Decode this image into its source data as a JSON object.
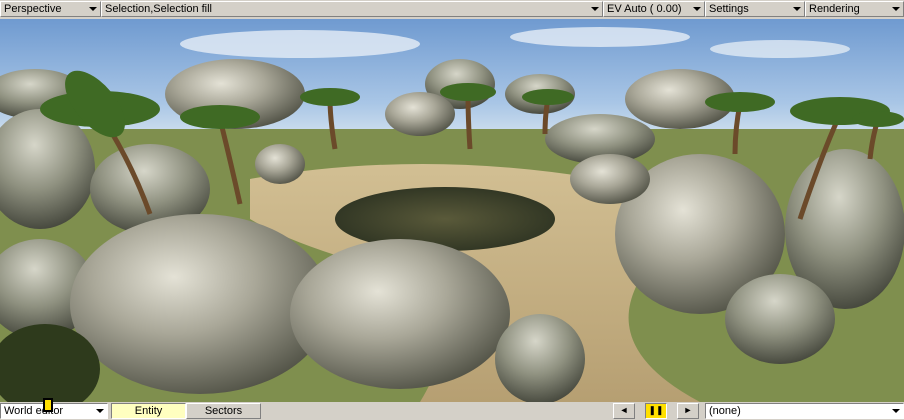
{
  "toolbar": {
    "view_mode": "Perspective",
    "selection_mode": "Selection,Selection fill",
    "exposure": "EV Auto ( 0.00)",
    "settings": "Settings",
    "rendering": "Rendering"
  },
  "bottom": {
    "mode_select": "World editor",
    "tabs": [
      {
        "label": "Entity",
        "active": true
      },
      {
        "label": "Sectors",
        "active": false
      }
    ],
    "playback": {
      "prev": "◄",
      "pause": "❚❚",
      "next": "►"
    },
    "object_select": "(none)"
  },
  "icons": [
    "chevron-down-icon",
    "play-back-icon",
    "pause-icon",
    "play-forward-icon"
  ],
  "colors": {
    "active_tab": "#ffffc0",
    "pause_active": "#ffe000",
    "chrome": "#d4d0c8"
  }
}
